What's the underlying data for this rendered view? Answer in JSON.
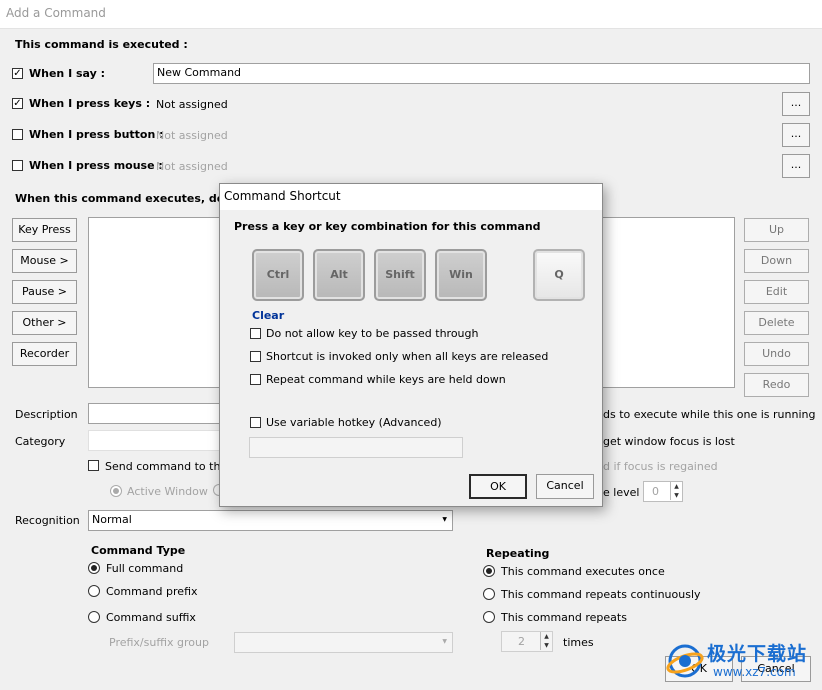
{
  "window": {
    "title": "Add a Command"
  },
  "main": {
    "executed_header": "This command is executed :",
    "when_say_label": "When I say :",
    "when_say_value": "New Command",
    "when_keys_label": "When I press keys :",
    "when_keys_value": "Not assigned",
    "when_button_label": "When I press button :",
    "when_button_value": "Not assigned",
    "when_mouse_label": "When I press mouse :",
    "when_mouse_value": "Not assigned",
    "ellipsis": "...",
    "executes_header_visible": "When this command executes, do the f",
    "left_buttons": [
      "Key Press",
      "Mouse >",
      "Pause >",
      "Other >",
      "Recorder"
    ],
    "right_buttons": [
      "Up",
      "Down",
      "Edit",
      "Delete",
      "Undo",
      "Redo"
    ],
    "description_label": "Description",
    "category_label": "Category",
    "send_command_partial": "Send command to this",
    "active_window": "Active Window",
    "right_partial_1": "ds to execute while this one is running",
    "right_partial_2": "get window focus is lost",
    "right_partial_3": "d if focus is regained",
    "right_partial_4": "e level",
    "level_value": "0",
    "recognition_label": "Recognition",
    "recognition_value": "Normal",
    "command_type_label": "Command Type",
    "command_types": [
      "Full command",
      "Command prefix",
      "Command suffix"
    ],
    "prefix_group_label": "Prefix/suffix group",
    "repeating_label": "Repeating",
    "repeat_options": [
      "This command executes once",
      "This command repeats continuously",
      "This command repeats"
    ],
    "repeat_count": "2",
    "times_label": "times",
    "ok_label": "OK",
    "cancel_label": "Cancel"
  },
  "dialog": {
    "title": "Command Shortcut",
    "instruction": "Press a key or key combination for this command",
    "keys": [
      "Ctrl",
      "Alt",
      "Shift",
      "Win"
    ],
    "key_selected": "Q",
    "clear_label": "Clear",
    "options": [
      "Do not allow key to be passed through",
      "Shortcut is invoked only when all keys are released",
      "Repeat command while keys are held down"
    ],
    "variable_hotkey": "Use variable hotkey (Advanced)",
    "ok_label": "OK",
    "cancel_label": "Cancel"
  },
  "watermark": {
    "text_cn": "极光下载站",
    "text_url": "www.xz7.com"
  },
  "colors": {
    "link_blue": "#003399",
    "watermark_blue": "#1a6ed1"
  }
}
